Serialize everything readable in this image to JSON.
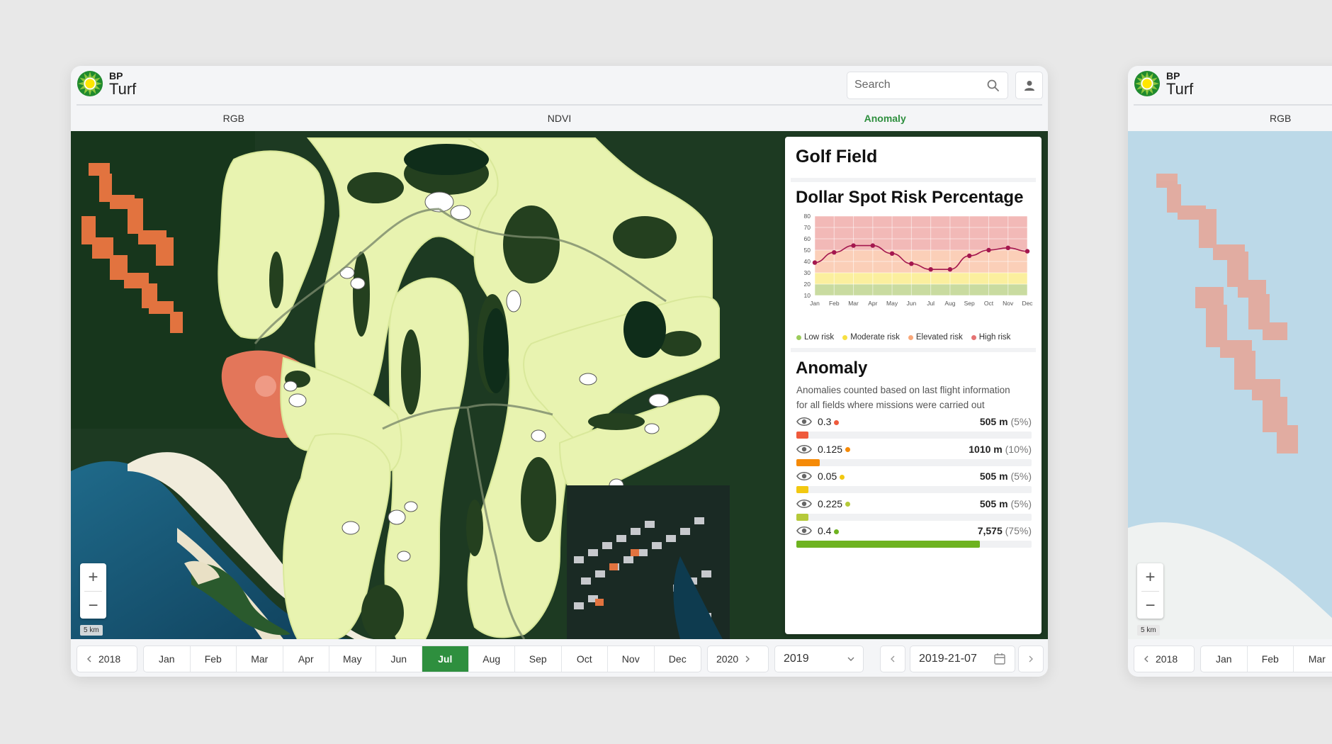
{
  "app": {
    "brand_top": "BP",
    "brand_name": "Turf"
  },
  "search": {
    "placeholder": "Search"
  },
  "tabs": [
    {
      "label": "RGB",
      "active": false
    },
    {
      "label": "NDVI",
      "active": false
    },
    {
      "label": "Anomaly",
      "active": true
    }
  ],
  "map": {
    "zoom_in": "+",
    "zoom_out": "−",
    "scale_label": "5 km"
  },
  "panel": {
    "title": "Golf Field",
    "risk_title": "Dollar Spot Risk Percentage",
    "anomaly_title": "Anomaly",
    "anomaly_description": "Anomalies counted based on last flight information for all fields where missions were carried out"
  },
  "chart_data": {
    "type": "line",
    "title": "Dollar Spot Risk Percentage",
    "categories": [
      "Jan",
      "Feb",
      "Mar",
      "Apr",
      "May",
      "Jun",
      "Jul",
      "Aug",
      "Sep",
      "Oct",
      "Nov",
      "Dec"
    ],
    "series": [
      {
        "values": [
          39,
          48,
          54,
          54,
          47,
          38,
          33,
          33,
          45,
          50,
          52,
          49
        ]
      }
    ],
    "y_ticks": [
      10,
      20,
      30,
      40,
      50,
      60,
      70,
      80
    ],
    "ylim": [
      10,
      80
    ],
    "grid": true,
    "bands": [
      {
        "label": "Low risk",
        "from": 10,
        "to": 20,
        "color": "#c9dba0",
        "legend_color": "#9ccc5b"
      },
      {
        "label": "Moderate risk",
        "from": 20,
        "to": 30,
        "color": "#fbef9e",
        "legend_color": "#f7e042"
      },
      {
        "label": "Elevated risk",
        "from": 30,
        "to": 50,
        "color": "#fbcfb8",
        "legend_color": "#f9a87a"
      },
      {
        "label": "High risk",
        "from": 50,
        "to": 80,
        "color": "#f2b9b7",
        "legend_color": "#e57373"
      }
    ],
    "line_color": "#a4174e",
    "legend_position": "bottom"
  },
  "anomalies": [
    {
      "value": "0.3",
      "color": "#ef5a3c",
      "distance": "505 m",
      "percent": "(5%)",
      "fraction": 0.05
    },
    {
      "value": "0.125",
      "color": "#f58a07",
      "distance": "1010 m",
      "percent": "(10%)",
      "fraction": 0.1
    },
    {
      "value": "0.05",
      "color": "#f2c811",
      "distance": "505 m",
      "percent": "(5%)",
      "fraction": 0.05
    },
    {
      "value": "0.225",
      "color": "#b5c93a",
      "distance": "505 m",
      "percent": "(5%)",
      "fraction": 0.05
    },
    {
      "value": "0.4",
      "color": "#6eb320",
      "distance": "7,575",
      "percent": "(75%)",
      "fraction": 0.78
    }
  ],
  "timeline": {
    "prev_year": "2018",
    "next_year": "2020",
    "months": [
      "Jan",
      "Feb",
      "Mar",
      "Apr",
      "May",
      "Jun",
      "Jul",
      "Aug",
      "Sep",
      "Oct",
      "Nov",
      "Dec"
    ],
    "active_month": "Jul",
    "year_select": "2019",
    "date": "2019-21-07"
  },
  "secondary": {
    "tab_label": "RGB",
    "scale_label": "5 km",
    "prev_year": "2018",
    "months": [
      "Jan",
      "Feb",
      "Mar"
    ]
  },
  "colors": {
    "accent": "#2e8f3e"
  }
}
